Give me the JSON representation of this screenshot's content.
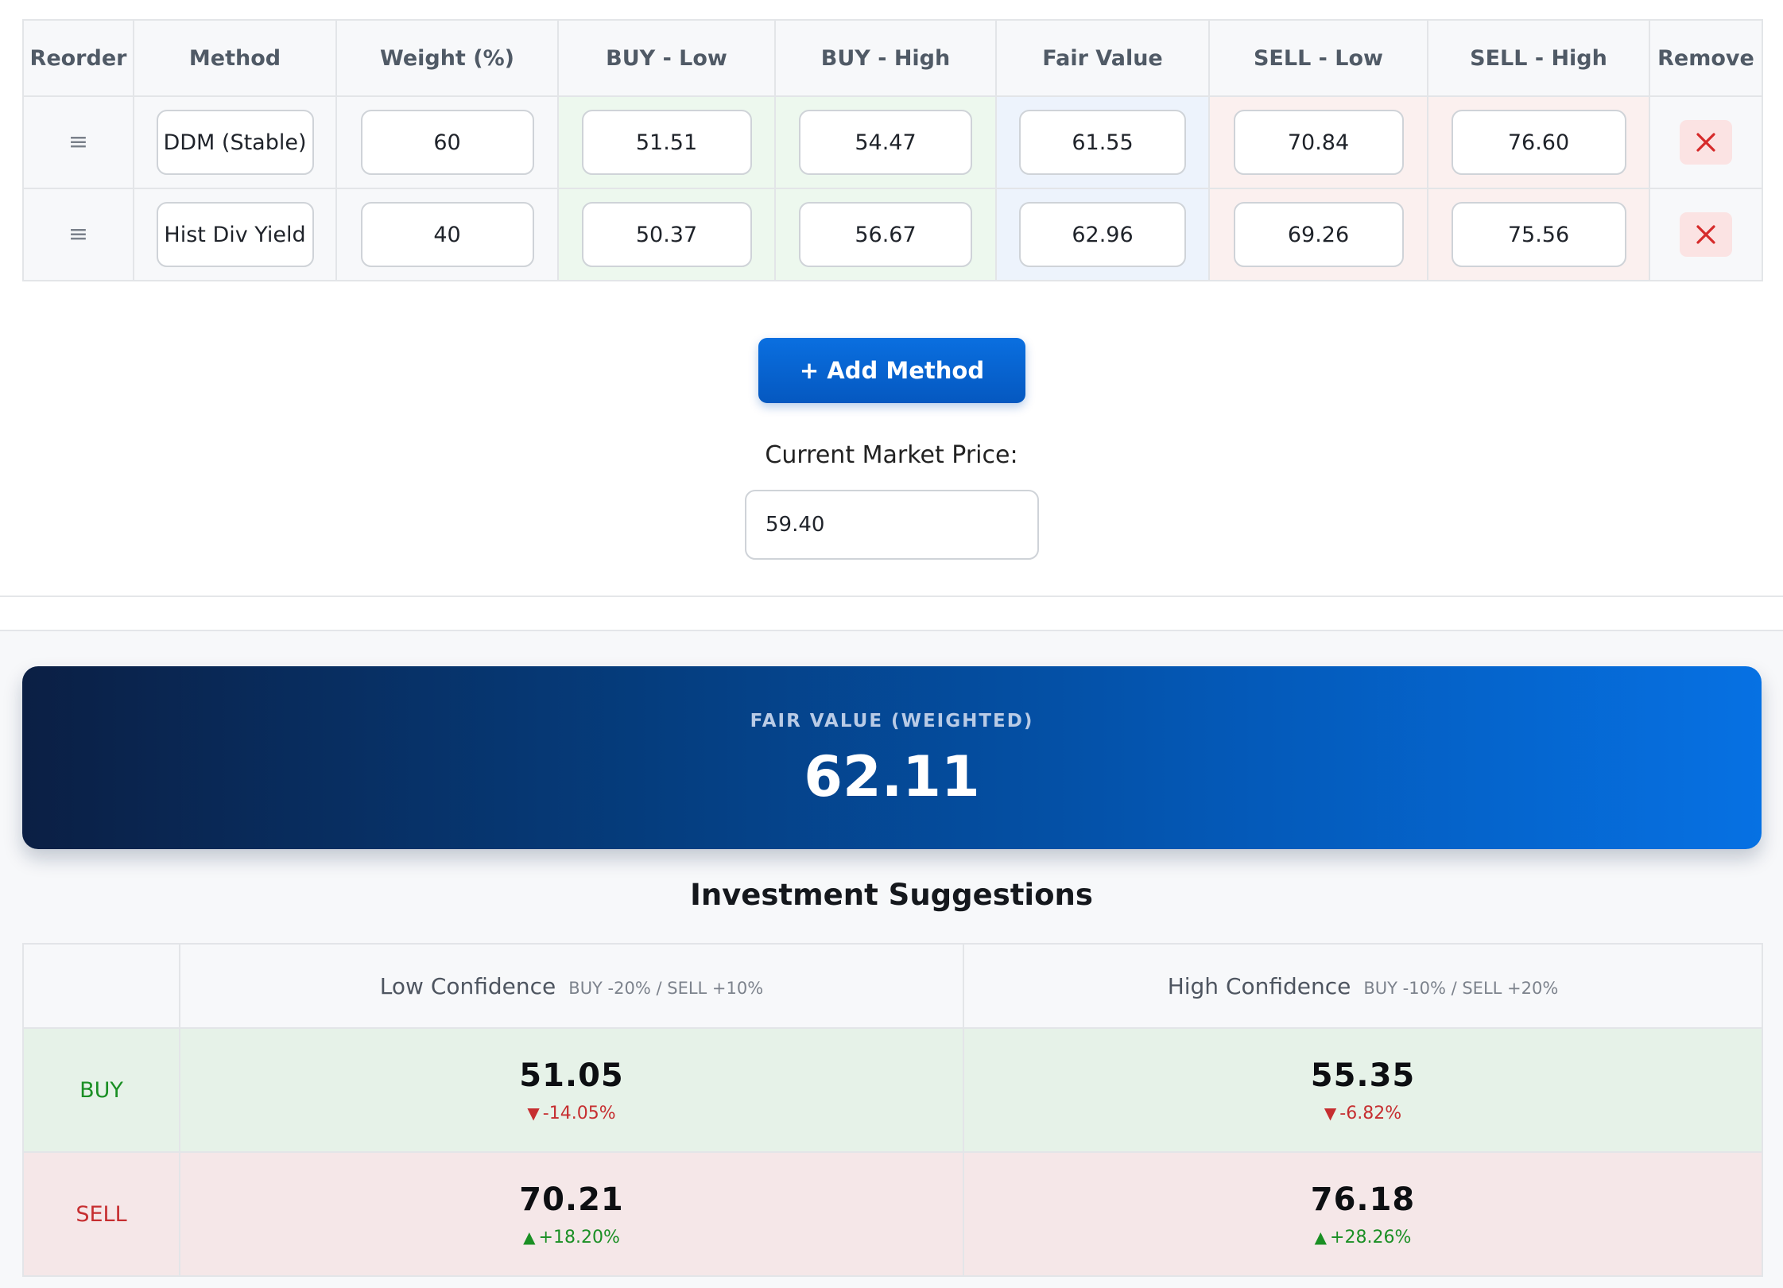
{
  "methods_table": {
    "headers": {
      "reorder": "Reorder",
      "method": "Method",
      "weight": "Weight (%)",
      "buy_low": "BUY - Low",
      "buy_high": "BUY - High",
      "fair_value": "Fair Value",
      "sell_low": "SELL - Low",
      "sell_high": "SELL - High",
      "remove": "Remove"
    },
    "rows": [
      {
        "method": "DDM (Stable)",
        "weight": "60",
        "buy_low": "51.51",
        "buy_high": "54.47",
        "fair_value": "61.55",
        "sell_low": "70.84",
        "sell_high": "76.60"
      },
      {
        "method": "Hist Div Yield",
        "weight": "40",
        "buy_low": "50.37",
        "buy_high": "56.67",
        "fair_value": "62.96",
        "sell_low": "69.26",
        "sell_high": "75.56"
      }
    ],
    "drag_icon": "≡",
    "remove_icon": "close-icon"
  },
  "add_method_label": "+ Add Method",
  "market_price": {
    "label": "Current Market Price:",
    "value": "59.40"
  },
  "fair_value": {
    "label": "FAIR VALUE (WEIGHTED)",
    "value": "62.11"
  },
  "suggestions": {
    "title": "Investment Suggestions",
    "low": {
      "name": "Low Confidence",
      "sub": "BUY -20% / SELL +10%"
    },
    "high": {
      "name": "High Confidence",
      "sub": "BUY -10% / SELL +20%"
    },
    "buy": {
      "label": "BUY",
      "low": {
        "value": "51.05",
        "change": "-14.05%"
      },
      "high": {
        "value": "55.35",
        "change": "-6.82%"
      }
    },
    "sell": {
      "label": "SELL",
      "low": {
        "value": "70.21",
        "change": "+18.20%"
      },
      "high": {
        "value": "76.18",
        "change": "+28.26%"
      }
    }
  },
  "colors": {
    "accent": "#0668d8",
    "buy": "#1a8f24",
    "sell": "#c62e30",
    "banner_start": "#0b1f44",
    "banner_end": "#0671e3"
  }
}
